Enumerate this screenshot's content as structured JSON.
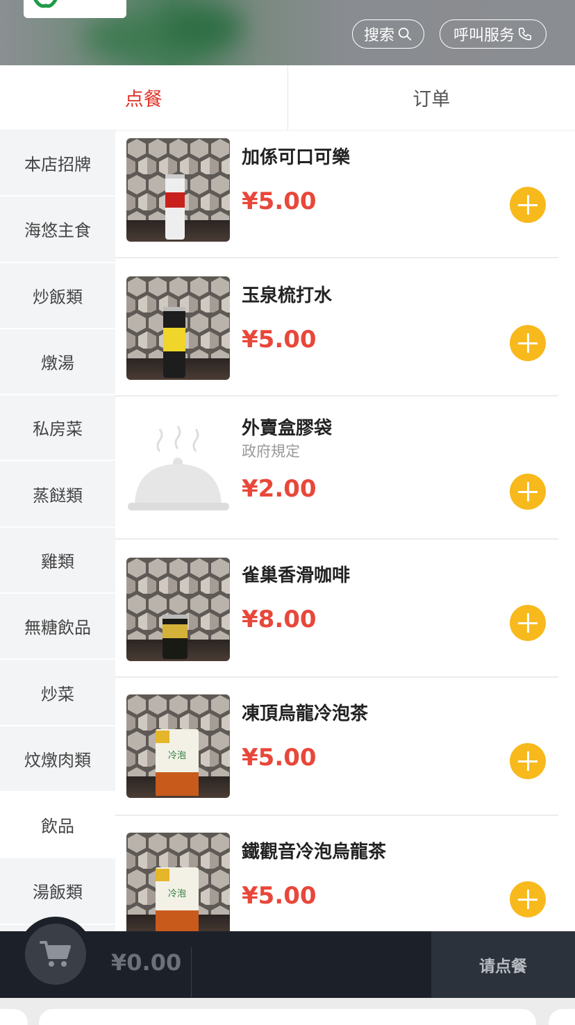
{
  "header": {
    "search_label": "搜索",
    "call_label": "呼叫服务",
    "search_icon": "search-icon",
    "call_icon": "phone-icon"
  },
  "tabs": [
    {
      "label": "点餐",
      "active": true
    },
    {
      "label": "订单",
      "active": false
    }
  ],
  "sidebar": {
    "items": [
      {
        "label": "本店招牌"
      },
      {
        "label": "海悠主食"
      },
      {
        "label": "炒飯類"
      },
      {
        "label": "燉湯"
      },
      {
        "label": "私房菜"
      },
      {
        "label": "蒸餸類"
      },
      {
        "label": "雞類"
      },
      {
        "label": "無糖飲品"
      },
      {
        "label": "炒菜"
      },
      {
        "label": "炆燉肉類"
      },
      {
        "label": "飲品",
        "active": true
      },
      {
        "label": "湯飯類"
      }
    ]
  },
  "menu": {
    "items": [
      {
        "name": "加係可口可樂",
        "price": "¥5.00",
        "image": "coke-can"
      },
      {
        "name": "玉泉梳打水",
        "price": "¥5.00",
        "image": "schweppes-can"
      },
      {
        "name": "外賣盒膠袋",
        "subtitle": "政府規定",
        "price": "¥2.00",
        "image": "placeholder-dish"
      },
      {
        "name": "雀巢香滑咖啡",
        "price": "¥8.00",
        "image": "nescafe-can"
      },
      {
        "name": "凍頂烏龍冷泡茶",
        "price": "¥5.00",
        "image": "tea-carton"
      },
      {
        "name": "鐵觀音冷泡烏龍茶",
        "price": "¥5.00",
        "image": "tea-carton"
      }
    ]
  },
  "cart": {
    "total": "¥0.00",
    "order_button": "请点餐",
    "icon": "cart-icon"
  },
  "colors": {
    "accent_red": "#e0322a",
    "price_red": "#e8473a",
    "add_yellow": "#f8b91c",
    "cart_bg": "#1c2129"
  }
}
